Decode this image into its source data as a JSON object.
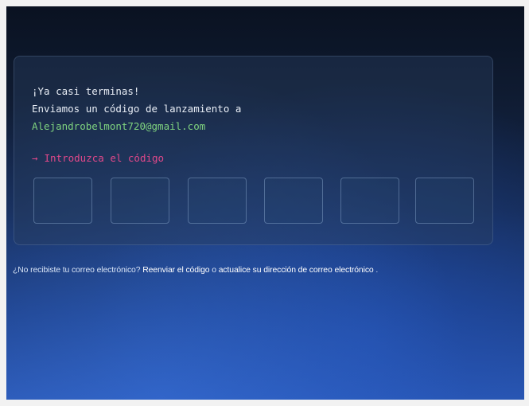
{
  "panel": {
    "title": "¡Ya casi terminas!",
    "sent_text": "Enviamos un código de lanzamiento a",
    "email": "Alejandrobelmont720@gmail.com",
    "prompt_arrow": "→",
    "prompt": "Introduzca el código",
    "code_boxes": [
      "",
      "",
      "",
      "",
      "",
      ""
    ]
  },
  "footer": {
    "question": "¿No recibiste tu correo electrónico? ",
    "resend_link": "Reenviar el código",
    "or_text": " o ",
    "update_link": "actualice su dirección de correo electrónico",
    "end": " ."
  },
  "colors": {
    "email": "#7fd37f",
    "prompt": "#e2488a",
    "text": "#e9eef6"
  }
}
